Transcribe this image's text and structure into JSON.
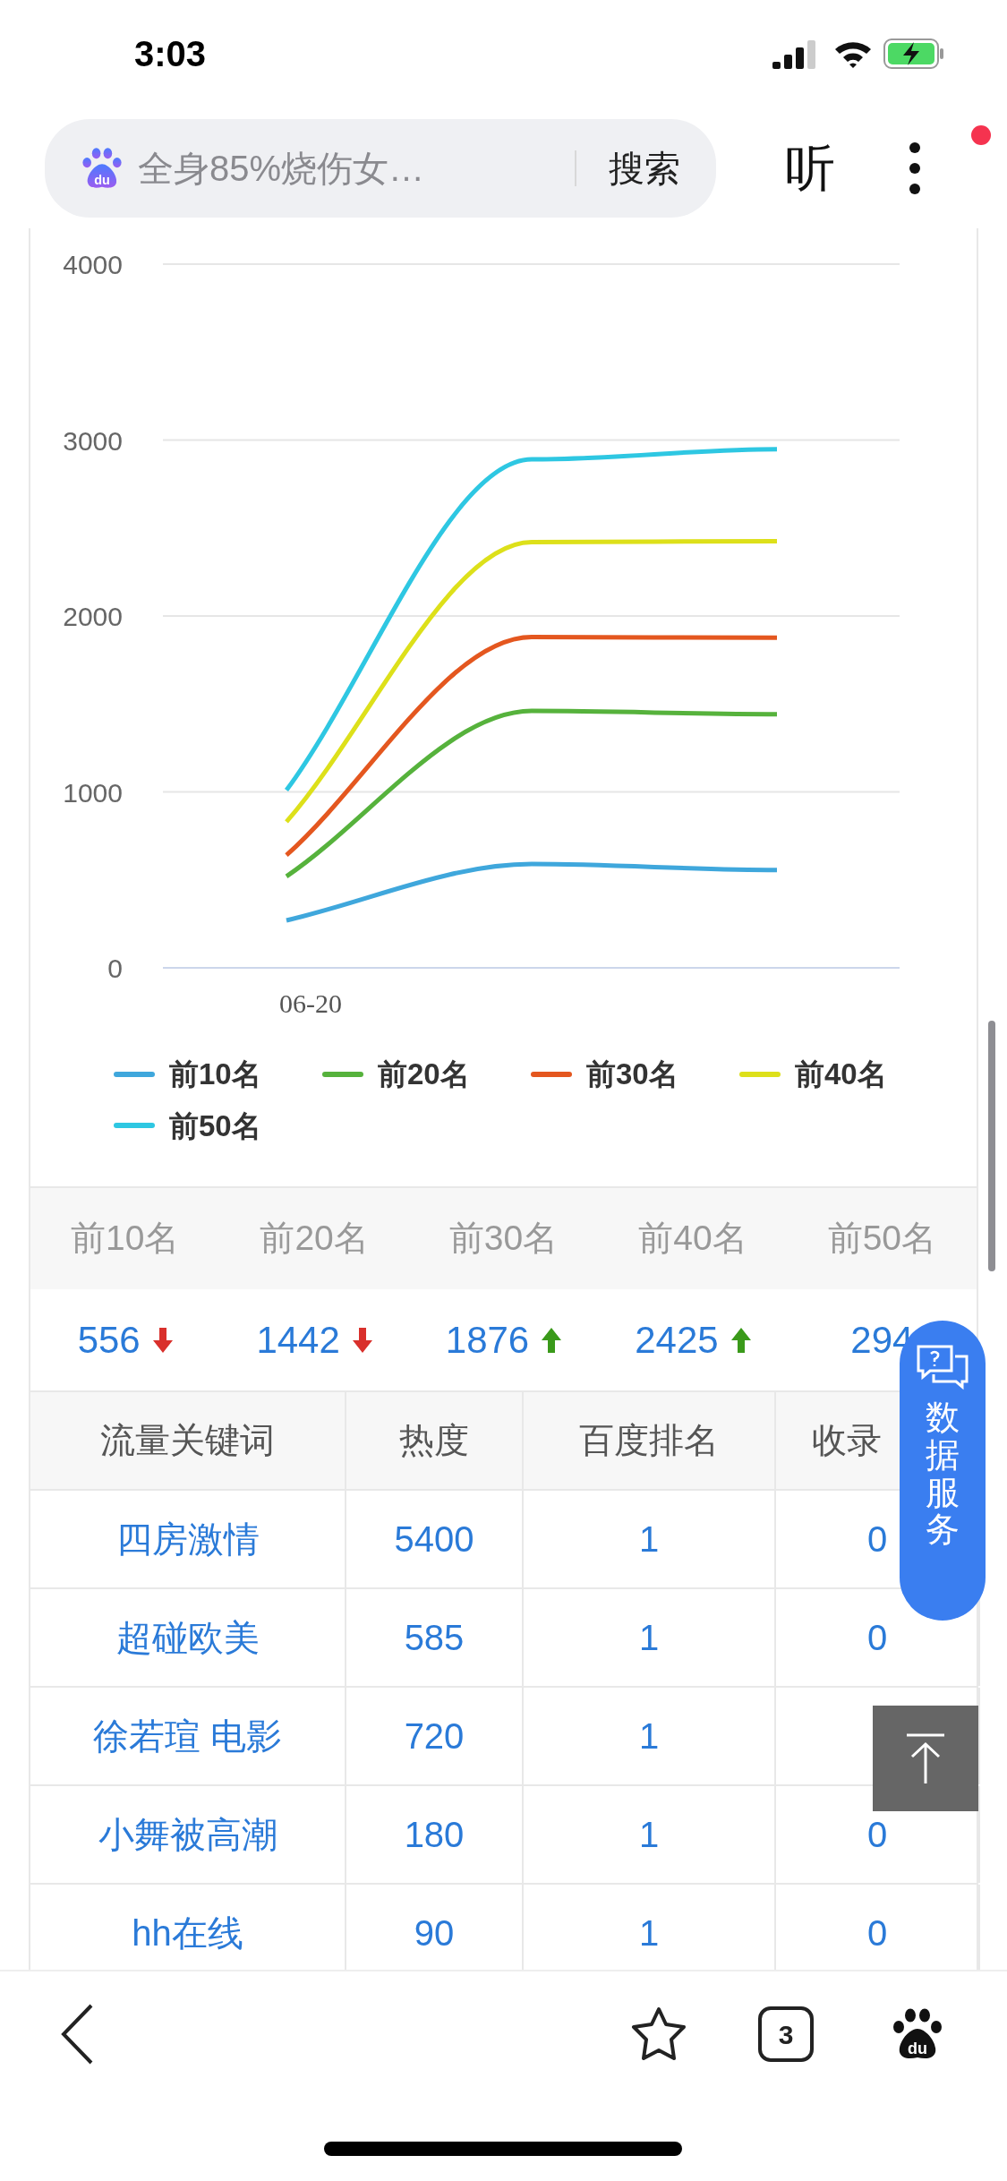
{
  "status_bar": {
    "time": "3:03"
  },
  "search_bar": {
    "query": "全身85%烧伤女…",
    "button": "搜索",
    "brand_mark": "du"
  },
  "listen_button": "听",
  "menu": {
    "notification_dot": true
  },
  "chart": {
    "first_date_label": "06-20",
    "chart_data": {
      "type": "line",
      "grid": true,
      "legend": "bottom",
      "ylim": [
        0,
        4000
      ],
      "yticks": [
        {
          "value": 0,
          "label": "0"
        },
        {
          "value": 1000,
          "label": "1000"
        },
        {
          "value": 2000,
          "label": "2000"
        },
        {
          "value": 3000,
          "label": "3000"
        },
        {
          "value": 4000,
          "label": "4000"
        }
      ],
      "series": [
        {
          "name": "前10名",
          "color": "#3fa7dc",
          "values": [
            270,
            590,
            556
          ]
        },
        {
          "name": "前20名",
          "color": "#56b23c",
          "values": [
            520,
            1460,
            1442
          ]
        },
        {
          "name": "前30名",
          "color": "#e4571f",
          "values": [
            640,
            1880,
            1876
          ]
        },
        {
          "name": "前40名",
          "color": "#dde01a",
          "values": [
            830,
            2420,
            2425
          ]
        },
        {
          "name": "前50名",
          "color": "#2ec7e2",
          "values": [
            1010,
            2890,
            2948
          ]
        }
      ]
    }
  },
  "rank_stats": [
    {
      "label": "前10名",
      "value": "556",
      "rising": false
    },
    {
      "label": "前20名",
      "value": "1442",
      "rising": false
    },
    {
      "label": "前30名",
      "value": "1876",
      "rising": true
    },
    {
      "label": "前40名",
      "value": "2425",
      "rising": true
    },
    {
      "label": "前50名",
      "value": "294"
    }
  ],
  "table": {
    "columns": [
      "流量关键词",
      "热度",
      "百度排名",
      "收录"
    ],
    "rows": [
      [
        "四房激情",
        "5400",
        "1",
        "0"
      ],
      [
        "超碰欧美",
        "585",
        "1",
        "0"
      ],
      [
        "徐若瑄 电影",
        "720",
        "1"
      ],
      [
        "小舞被高潮",
        "180",
        "1",
        "0"
      ],
      [
        "hh在线",
        "90",
        "1",
        "0"
      ]
    ]
  },
  "data_service_button": "数据服务",
  "bottom_bar": {
    "tab_count": "3",
    "brand_mark": "du"
  }
}
